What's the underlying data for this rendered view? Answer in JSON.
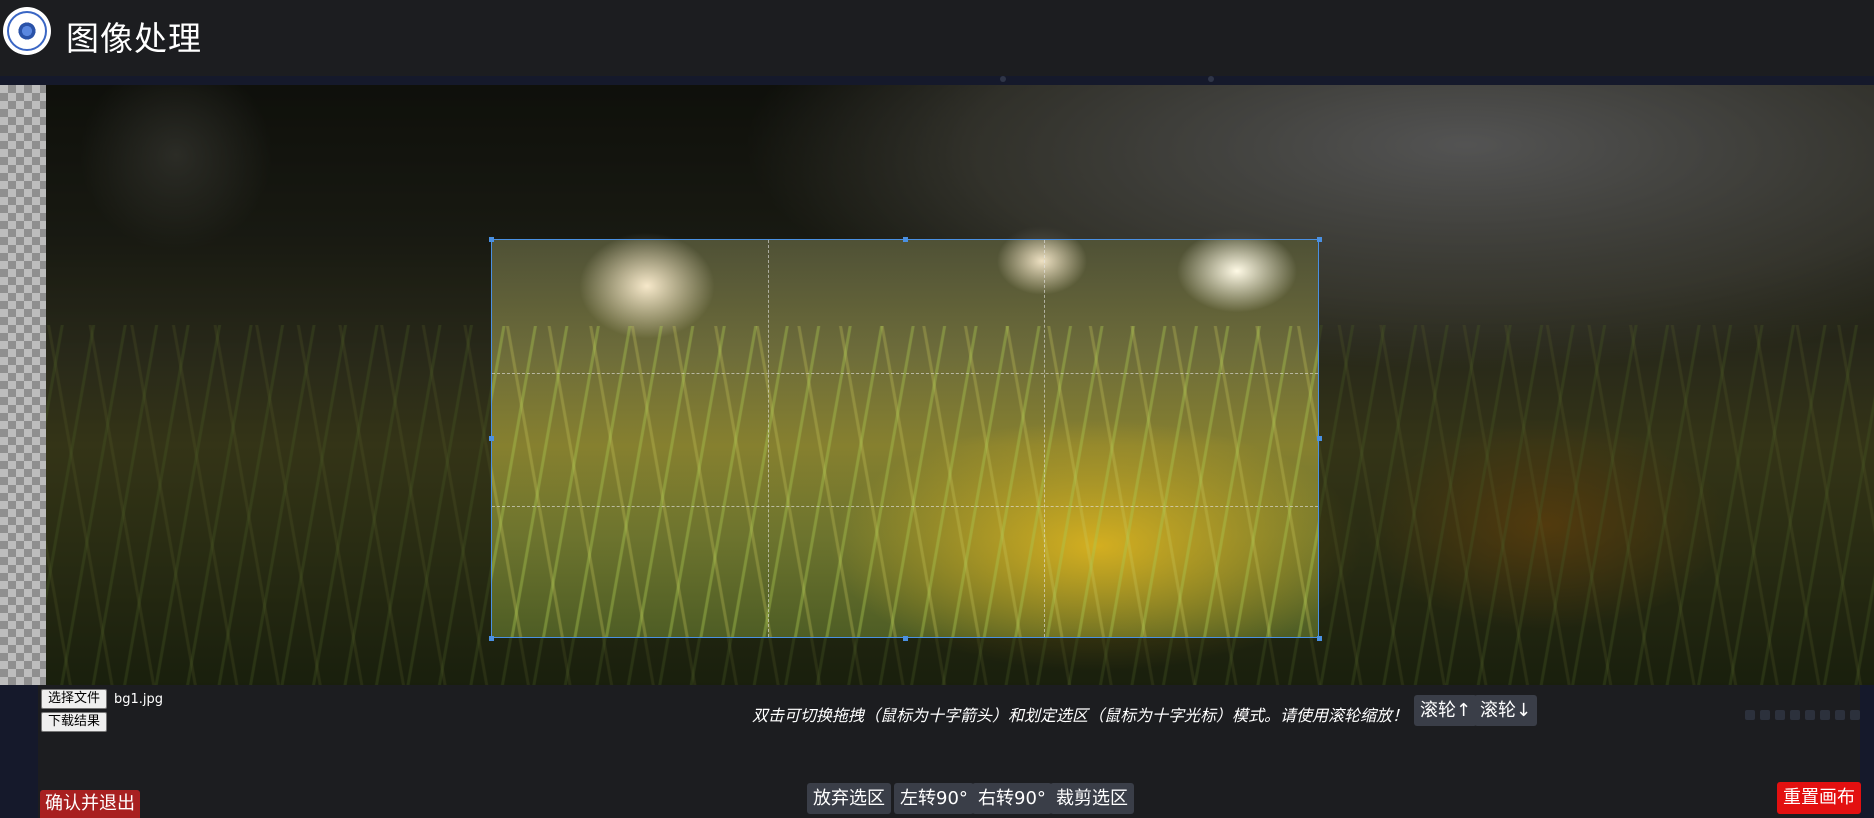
{
  "header": {
    "title": "图像处理",
    "logo_icon": "lotus-logo-icon"
  },
  "file": {
    "choose_label": "选择文件",
    "download_label": "下载结果",
    "filename": "bg1.jpg"
  },
  "hint": "双击可切换拖拽（鼠标为十字箭头）和划定选区（鼠标为十字光标）模式。请使用滚轮缩放！",
  "wheel": {
    "up_label": "滚轮↑",
    "down_label": "滚轮↓"
  },
  "actions": {
    "discard_label": "放弃选区",
    "rotate_left_label": "左转90°",
    "rotate_right_label": "右转90°",
    "crop_label": "裁剪选区"
  },
  "confirm_label": "确认并退出",
  "reset_label": "重置画布",
  "colors": {
    "selection": "#4a90e2",
    "reset": "#e31010",
    "confirm": "#a82020"
  }
}
